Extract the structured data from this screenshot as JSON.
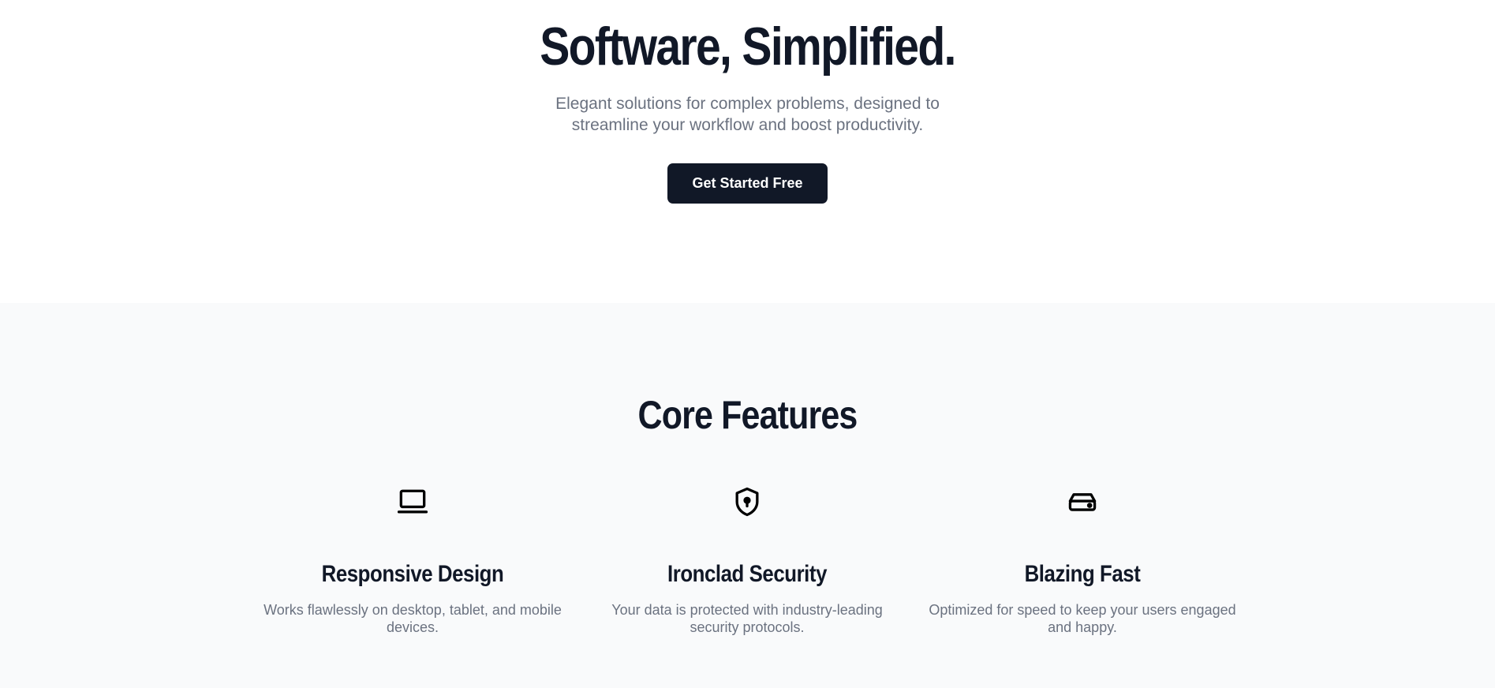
{
  "hero": {
    "title": "Software, Simplified.",
    "subtitle": "Elegant solutions for complex problems, designed to streamline your workflow and boost productivity.",
    "cta_label": "Get Started Free"
  },
  "features": {
    "title": "Core Features",
    "items": [
      {
        "icon": "laptop-icon",
        "title": "Responsive Design",
        "description": "Works flawlessly on desktop, tablet, and mobile devices."
      },
      {
        "icon": "shield-lock-icon",
        "title": "Ironclad Security",
        "description": "Your data is protected with industry-leading security protocols."
      },
      {
        "icon": "hard-drive-icon",
        "title": "Blazing Fast",
        "description": "Optimized for speed to keep your users engaged and happy."
      }
    ]
  },
  "colors": {
    "primary": "#111827",
    "muted_text": "#6b7280",
    "section_background": "#f9fafb"
  }
}
